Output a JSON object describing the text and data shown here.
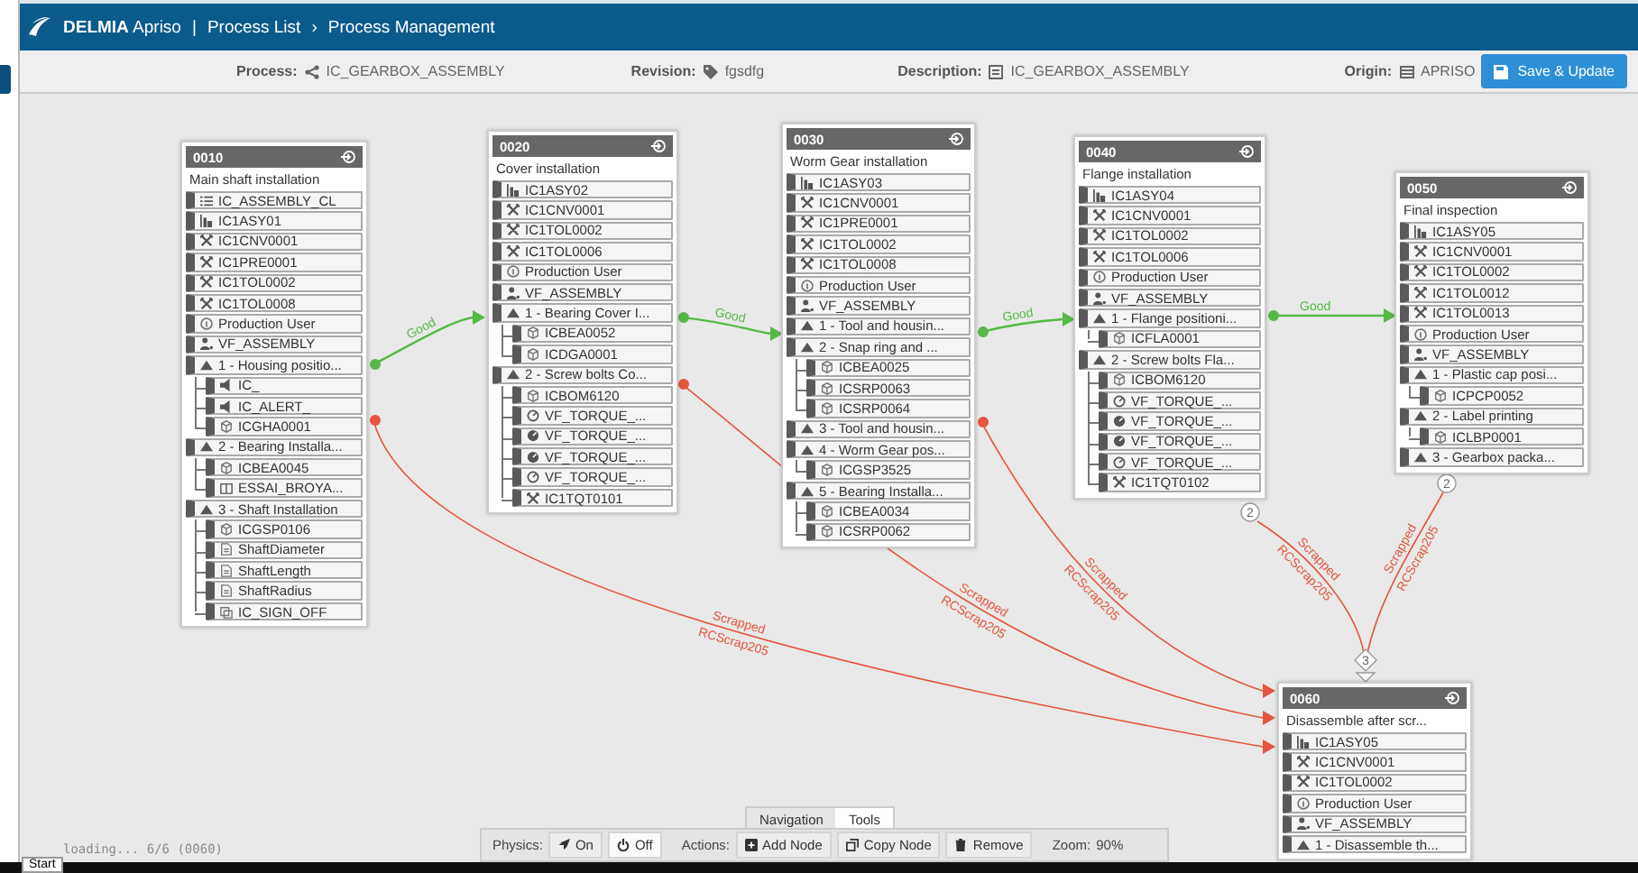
{
  "header": {
    "brand": "**DELMIA** Apriso",
    "separator": "|",
    "breadcrumbs": [
      {
        "label": "Process List"
      },
      {
        "label": "›"
      },
      {
        "label": "Process Management"
      }
    ]
  },
  "info_bar": {
    "fields": [
      {
        "kind": "process",
        "label": "Process:",
        "value": "IC_GEARBOX_ASSEMBLY"
      },
      {
        "kind": "revision",
        "label": "Revision:",
        "value": "fgsdfg"
      },
      {
        "kind": "description",
        "label": "Description:",
        "value": "IC_GEARBOX_ASSEMBLY"
      },
      {
        "kind": "origin",
        "label": "Origin:",
        "value": "APRISO"
      }
    ],
    "save_button": "Save & Update"
  },
  "nodes": [
    {
      "id": "0010",
      "title": "Main shaft installation",
      "items": [
        {
          "kind": "list",
          "label": "IC_ASSEMBLY_CL"
        },
        {
          "kind": "asy",
          "label": "IC1ASY01"
        },
        {
          "kind": "tool",
          "label": "IC1CNV0001"
        },
        {
          "kind": "tool",
          "label": "IC1PRE0001"
        },
        {
          "kind": "tool",
          "label": "IC1TOL0002"
        },
        {
          "kind": "tool",
          "label": "IC1TOL0008"
        },
        {
          "kind": "user",
          "label": "Production User"
        },
        {
          "kind": "group",
          "label": "VF_ASSEMBLY"
        },
        {
          "kind": "step",
          "label": "1 - Housing positio...",
          "children": [
            {
              "kind": "alert",
              "label": "IC_"
            },
            {
              "kind": "alert",
              "label": "IC_ALERT_"
            },
            {
              "kind": "part",
              "label": "ICGHA0001"
            }
          ]
        },
        {
          "kind": "step",
          "label": "2 - Bearing Installa...",
          "children": [
            {
              "kind": "part",
              "label": "ICBEA0045"
            },
            {
              "kind": "book",
              "label": "ESSAI_BROYA..."
            }
          ]
        },
        {
          "kind": "step",
          "label": "3 - Shaft Installation",
          "children": [
            {
              "kind": "part",
              "label": "ICGSP0106"
            },
            {
              "kind": "param",
              "label": "ShaftDiameter"
            },
            {
              "kind": "param",
              "label": "ShaftLength"
            },
            {
              "kind": "param",
              "label": "ShaftRadius"
            },
            {
              "kind": "sign",
              "label": "IC_SIGN_OFF"
            }
          ]
        }
      ]
    },
    {
      "id": "0020",
      "title": "Cover installation",
      "items": [
        {
          "kind": "asy",
          "label": "IC1ASY02"
        },
        {
          "kind": "tool",
          "label": "IC1CNV0001"
        },
        {
          "kind": "tool",
          "label": "IC1TOL0002"
        },
        {
          "kind": "tool",
          "label": "IC1TOL0006"
        },
        {
          "kind": "user",
          "label": "Production User"
        },
        {
          "kind": "group",
          "label": "VF_ASSEMBLY"
        },
        {
          "kind": "step",
          "label": "1 - Bearing Cover I...",
          "children": [
            {
              "kind": "part",
              "label": "ICBEA0052"
            },
            {
              "kind": "part",
              "label": "ICDGA0001"
            }
          ]
        },
        {
          "kind": "step",
          "label": "2 - Screw bolts Co...",
          "children": [
            {
              "kind": "part",
              "label": "ICBOM6120"
            },
            {
              "kind": "gauge",
              "label": "VF_TORQUE_..."
            },
            {
              "kind": "gauge_filled",
              "label": "VF_TORQUE_..."
            },
            {
              "kind": "gauge_filled",
              "label": "VF_TORQUE_..."
            },
            {
              "kind": "gauge",
              "label": "VF_TORQUE_..."
            },
            {
              "kind": "tool",
              "label": "IC1TQT0101"
            }
          ]
        }
      ]
    },
    {
      "id": "0030",
      "title": "Worm Gear installation",
      "items": [
        {
          "kind": "asy",
          "label": "IC1ASY03"
        },
        {
          "kind": "tool",
          "label": "IC1CNV0001"
        },
        {
          "kind": "tool",
          "label": "IC1PRE0001"
        },
        {
          "kind": "tool",
          "label": "IC1TOL0002"
        },
        {
          "kind": "tool",
          "label": "IC1TOL0008"
        },
        {
          "kind": "user",
          "label": "Production User"
        },
        {
          "kind": "group",
          "label": "VF_ASSEMBLY"
        },
        {
          "kind": "step",
          "label": "1 - Tool and housin..."
        },
        {
          "kind": "step",
          "label": "2 - Snap ring and ...",
          "children": [
            {
              "kind": "part",
              "label": "ICBEA0025"
            },
            {
              "kind": "part",
              "label": "ICSRP0063"
            },
            {
              "kind": "part",
              "label": "ICSRP0064"
            }
          ]
        },
        {
          "kind": "step",
          "label": "3 - Tool and housin..."
        },
        {
          "kind": "step",
          "label": "4 - Worm Gear pos...",
          "children": [
            {
              "kind": "part",
              "label": "ICGSP3525"
            }
          ]
        },
        {
          "kind": "step",
          "label": "5 - Bearing Installa...",
          "children": [
            {
              "kind": "part",
              "label": "ICBEA0034"
            },
            {
              "kind": "part",
              "label": "ICSRP0062"
            }
          ]
        }
      ]
    },
    {
      "id": "0040",
      "title": "Flange installation",
      "out_count": "2",
      "items": [
        {
          "kind": "asy",
          "label": "IC1ASY04"
        },
        {
          "kind": "tool",
          "label": "IC1CNV0001"
        },
        {
          "kind": "tool",
          "label": "IC1TOL0002"
        },
        {
          "kind": "tool",
          "label": "IC1TOL0006"
        },
        {
          "kind": "user",
          "label": "Production User"
        },
        {
          "kind": "group",
          "label": "VF_ASSEMBLY"
        },
        {
          "kind": "step",
          "label": "1 - Flange positioni...",
          "children": [
            {
              "kind": "part",
              "label": "ICFLA0001"
            }
          ]
        },
        {
          "kind": "step",
          "label": "2 - Screw bolts Fla...",
          "children": [
            {
              "kind": "part",
              "label": "ICBOM6120"
            },
            {
              "kind": "gauge",
              "label": "VF_TORQUE_..."
            },
            {
              "kind": "gauge_filled",
              "label": "VF_TORQUE_..."
            },
            {
              "kind": "gauge_filled",
              "label": "VF_TORQUE_..."
            },
            {
              "kind": "gauge",
              "label": "VF_TORQUE_..."
            },
            {
              "kind": "tool",
              "label": "IC1TQT0102"
            }
          ]
        }
      ]
    },
    {
      "id": "0050",
      "title": "Final inspection",
      "out_count": "2",
      "items": [
        {
          "kind": "asy",
          "label": "IC1ASY05"
        },
        {
          "kind": "tool",
          "label": "IC1CNV0001"
        },
        {
          "kind": "tool",
          "label": "IC1TOL0002"
        },
        {
          "kind": "tool",
          "label": "IC1TOL0012"
        },
        {
          "kind": "tool",
          "label": "IC1TOL0013"
        },
        {
          "kind": "user",
          "label": "Production User"
        },
        {
          "kind": "group",
          "label": "VF_ASSEMBLY"
        },
        {
          "kind": "step",
          "label": "1 - Plastic cap posi...",
          "children": [
            {
              "kind": "part",
              "label": "ICPCP0052"
            }
          ]
        },
        {
          "kind": "step",
          "label": "2 - Label printing",
          "children": [
            {
              "kind": "part",
              "label": "ICLBP0001"
            }
          ]
        },
        {
          "kind": "step",
          "label": "3 - Gearbox packa..."
        }
      ]
    },
    {
      "id": "0060",
      "title": "Disassemble after scr...",
      "in_count": "3",
      "items": [
        {
          "kind": "asy",
          "label": "IC1ASY05"
        },
        {
          "kind": "tool",
          "label": "IC1CNV0001"
        },
        {
          "kind": "tool",
          "label": "IC1TOL0002"
        },
        {
          "kind": "user",
          "label": "Production User"
        },
        {
          "kind": "group",
          "label": "VF_ASSEMBLY"
        },
        {
          "kind": "step",
          "label": "1 - Disassemble th..."
        }
      ]
    }
  ],
  "edges": [
    {
      "kind": "good",
      "labels": [
        "Good"
      ]
    },
    {
      "kind": "good",
      "labels": [
        "Good"
      ]
    },
    {
      "kind": "good",
      "labels": [
        "Good"
      ]
    },
    {
      "kind": "good",
      "labels": [
        "Good"
      ]
    },
    {
      "kind": "scrap",
      "labels": [
        "Scrapped",
        "RCScrap205"
      ]
    },
    {
      "kind": "scrap",
      "labels": [
        "Scrapped",
        "RCScrap205"
      ]
    },
    {
      "kind": "scrap",
      "labels": [
        "Scrapped",
        "RCScrap205"
      ]
    },
    {
      "kind": "scrap",
      "labels": [
        "Scrapped",
        "RCScrap205"
      ]
    },
    {
      "kind": "scrap",
      "labels": [
        "Scrapped",
        "RCScrap205"
      ]
    }
  ],
  "bottom_panel": {
    "tabs": [
      {
        "label": "Navigation",
        "selected": true
      },
      {
        "label": "Tools",
        "selected": false
      }
    ],
    "physics_label": "Physics:",
    "physics": [
      {
        "kind": "rocket",
        "label": "On",
        "selected": false
      },
      {
        "kind": "power",
        "label": "Off",
        "selected": true
      }
    ],
    "actions_label": "Actions:",
    "actions": [
      {
        "kind": "add",
        "label": "Add Node"
      },
      {
        "kind": "copy",
        "label": "Copy Node"
      },
      {
        "kind": "trash",
        "label": "Remove"
      }
    ],
    "zoom_label": "Zoom:",
    "zoom_value": "90%"
  },
  "status_text": "loading... 6/6 (0060)",
  "start_button": "Start"
}
